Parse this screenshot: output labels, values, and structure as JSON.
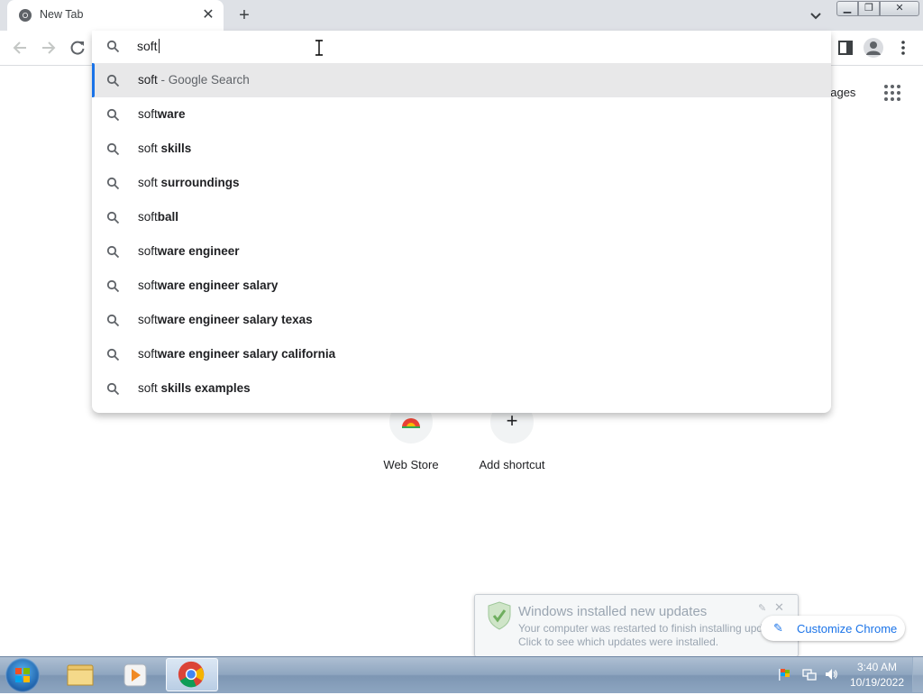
{
  "browser": {
    "tab_title": "New Tab",
    "omnibox_text": "soft"
  },
  "suggestions": [
    {
      "typed": "soft",
      "completion": "",
      "hint": " - Google Search",
      "selected": true
    },
    {
      "typed": "soft",
      "completion": "ware",
      "hint": ""
    },
    {
      "typed": "soft ",
      "completion": "skills",
      "hint": ""
    },
    {
      "typed": "soft ",
      "completion": "surroundings",
      "hint": ""
    },
    {
      "typed": "soft",
      "completion": "ball",
      "hint": ""
    },
    {
      "typed": "soft",
      "completion": "ware engineer",
      "hint": ""
    },
    {
      "typed": "soft",
      "completion": "ware engineer salary",
      "hint": ""
    },
    {
      "typed": "soft",
      "completion": "ware engineer salary texas",
      "hint": ""
    },
    {
      "typed": "soft",
      "completion": "ware engineer salary california",
      "hint": ""
    },
    {
      "typed": "soft ",
      "completion": "skills examples",
      "hint": ""
    }
  ],
  "page": {
    "images_link": "nages",
    "shortcuts": [
      {
        "label": "Web Store"
      },
      {
        "label": "Add shortcut"
      }
    ],
    "customize_label": "Customize Chrome"
  },
  "notification": {
    "title": "Windows installed new updates",
    "line1": "Your computer was restarted to finish installing updates.",
    "line2": "Click to see which updates were installed."
  },
  "taskbar": {
    "time": "3:40 AM",
    "date": "10/19/2022"
  },
  "colors": {
    "accent": "#1a73e8",
    "selected_row": "#e8e8e9",
    "tab_strip": "#dee1e6"
  }
}
